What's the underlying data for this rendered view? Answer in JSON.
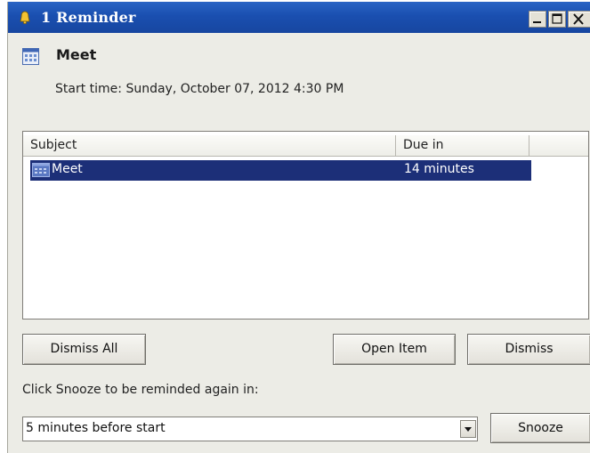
{
  "window": {
    "title": "1 Reminder"
  },
  "reminder": {
    "title": "Meet",
    "start_time": "Start time: Sunday, October 07, 2012 4:30 PM"
  },
  "list": {
    "columns": [
      "Subject",
      "Due in"
    ],
    "rows": [
      {
        "subject": "Meet",
        "due": "14 minutes",
        "selected": true
      }
    ]
  },
  "buttons": {
    "dismiss_all": "Dismiss All",
    "open_item": "Open Item",
    "dismiss": "Dismiss",
    "snooze": "Snooze"
  },
  "snooze": {
    "label": "Click Snooze to be reminded again in:",
    "selected_option": "5 minutes before start"
  },
  "icons": {
    "title": "bell-icon",
    "appointment": "calendar-icon",
    "row": "calendar-icon",
    "dropdown": "chevron-down-icon"
  },
  "colors": {
    "titlebar": "#1a4fb0",
    "selection": "#1c2f78",
    "window_bg": "#ecece6"
  }
}
